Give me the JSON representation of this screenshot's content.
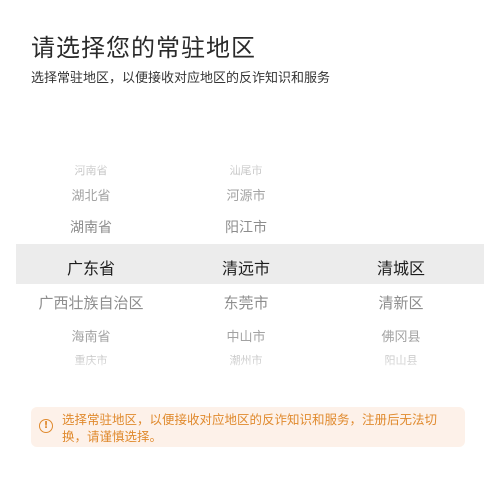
{
  "header": {
    "title": "请选择您的常驻地区",
    "subtitle": "选择常驻地区，以便接收对应地区的反诈知识和服务"
  },
  "picker": {
    "province": {
      "above": [
        "河南省",
        "湖北省",
        "湖南省"
      ],
      "selected": "广东省",
      "below": [
        "广西壮族自治区",
        "海南省",
        "重庆市"
      ]
    },
    "city": {
      "above": [
        "汕尾市",
        "河源市",
        "阳江市"
      ],
      "selected": "清远市",
      "below": [
        "东莞市",
        "中山市",
        "潮州市"
      ]
    },
    "district": {
      "above": [
        "",
        "",
        ""
      ],
      "selected": "清城区",
      "below": [
        "清新区",
        "佛冈县",
        "阳山县"
      ]
    }
  },
  "notice": {
    "icon": "warning-info-icon",
    "color": "#e08a2e",
    "text": "选择常驻地区，以便接收对应地区的反诈知识和服务，注册后无法切换，请谨慎选择。"
  }
}
